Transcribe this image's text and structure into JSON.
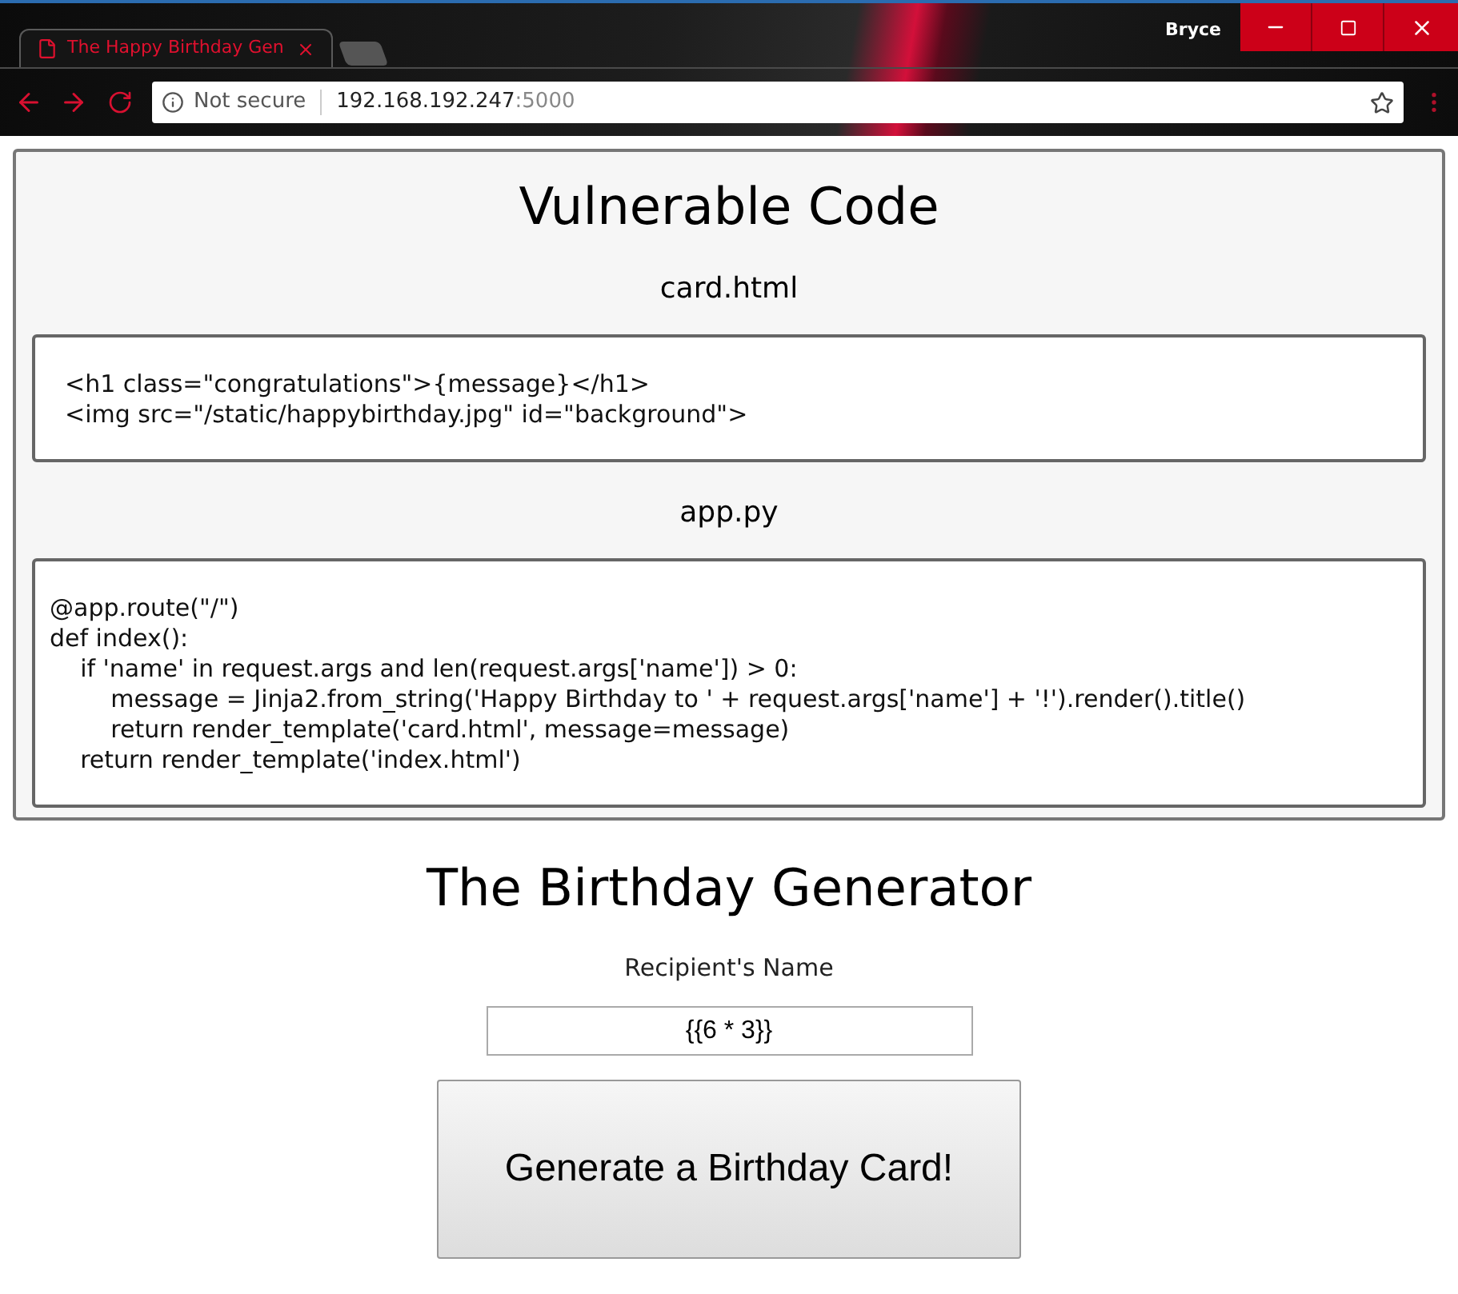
{
  "browser": {
    "tabs": [
      {
        "title": "The Happy Birthday Gen",
        "selected": true
      }
    ],
    "profile": "Bryce",
    "address_bar": {
      "security": "Not secure",
      "host": "192.168.192.247",
      "port": ":5000"
    }
  },
  "vulnerable_code": {
    "title": "Vulnerable Code",
    "files": [
      {
        "name": "card.html",
        "lines": [
          "  <h1 class=\"congratulations\">{message}</h1>",
          "  <img src=\"/static/happybirthday.jpg\" id=\"background\">"
        ]
      },
      {
        "name": "app.py",
        "lines": [
          "@app.route(\"/\")",
          "def index():",
          "    if 'name' in request.args and len(request.args['name']) > 0:",
          "        message = Jinja2.from_string('Happy Birthday to ' + request.args['name'] + '!').render().title()",
          "        return render_template('card.html', message=message)",
          "    return render_template('index.html')"
        ]
      }
    ]
  },
  "generator": {
    "title": "The Birthday Generator",
    "name_field": {
      "label": "Recipient's Name",
      "value": "{{6 * 3}}"
    },
    "submit_button": "Generate a Birthday Card!"
  }
}
